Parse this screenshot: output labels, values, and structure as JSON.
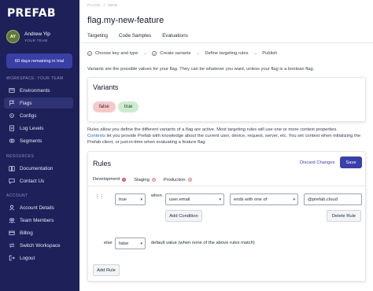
{
  "sidebar": {
    "logo": "PREFAB",
    "user": {
      "initials": "AY",
      "name": "Andrew Yip",
      "role": "YOUR TEAM"
    },
    "trial": "60 days remaining in trial",
    "sections": {
      "workspace": "WORKSPACE: YOUR TEAM",
      "resources": "RESOURCES",
      "account": "ACCOUNT"
    },
    "workspace_items": [
      {
        "label": "Environments",
        "icon": "environments-icon"
      },
      {
        "label": "Flags",
        "icon": "flag-icon"
      },
      {
        "label": "Configs",
        "icon": "gear-icon"
      },
      {
        "label": "Log Levels",
        "icon": "log-icon"
      },
      {
        "label": "Segments",
        "icon": "segments-icon"
      }
    ],
    "resource_items": [
      {
        "label": "Documentation",
        "icon": "book-icon"
      },
      {
        "label": "Contact Us",
        "icon": "chat-icon"
      }
    ],
    "account_items": [
      {
        "label": "Account Details",
        "icon": "user-icon"
      },
      {
        "label": "Team Members",
        "icon": "team-icon"
      },
      {
        "label": "Billing",
        "icon": "card-icon"
      },
      {
        "label": "Switch Workspace",
        "icon": "switch-icon"
      },
      {
        "label": "Logout",
        "icon": "logout-icon"
      }
    ]
  },
  "main": {
    "breadcrumb": [
      "FLAGS",
      "/",
      "NEW"
    ],
    "title": "flag.my-new-feature",
    "tabs": [
      "Targeting",
      "Code Samples",
      "Evaluations"
    ],
    "steps": [
      "Choose key and type",
      "Create variants",
      "Define targeting rules",
      "Publish"
    ],
    "help": "Variants are the possible values for your flag. They can be whatever you want, unless your flag is a boolean flag.",
    "variants": {
      "heading": "Variants",
      "values": [
        "false",
        "true"
      ]
    },
    "rules_text_1": "Rules allow you define the different variants of a flag are active. Most targeting rules will use one or more context properties.",
    "rules_link": "Contexts",
    "rules_text_2": " let you provide Prefab with knowledge about the current user, device, request, server, etc. You set context when initializing the Prefab client, or just-in-time when evaluating a feature flag.",
    "rules": {
      "heading": "Rules",
      "discard": "Discard Changes",
      "save": "Save",
      "env_tabs": [
        "Development",
        "Staging",
        "Production"
      ],
      "rule": {
        "value": "true",
        "when": "when",
        "property": "user.email",
        "operator": "ends with one of",
        "match": "@prefab.cloud",
        "add_condition": "Add Condition",
        "delete_rule": "Delete Rule"
      },
      "else": "else",
      "default_value": "false",
      "default_text": "default value (when none of the above rules match)",
      "add_rule": "Add Rule"
    }
  },
  "colors": {
    "sidebar": "#1d2059",
    "accent": "#3b3fa8",
    "false_pill": "#f8c8c8",
    "true_pill": "#cdeccf"
  }
}
